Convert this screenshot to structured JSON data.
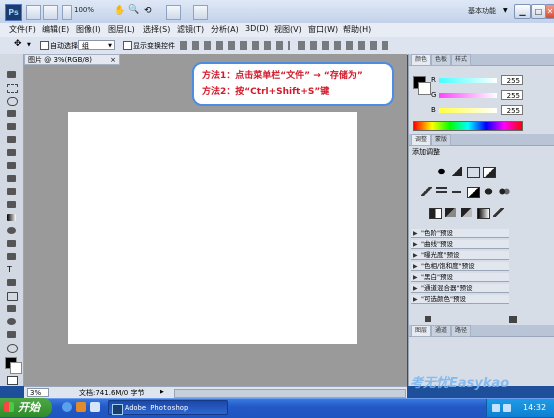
{
  "titlebar": {
    "ps_logo": "Ps",
    "zoom": "100%",
    "workspace": "基本功能",
    "min": "▁",
    "max": "□",
    "close": "✕"
  },
  "menu": [
    "文件(F)",
    "编辑(E)",
    "图像(I)",
    "图层(L)",
    "选择(S)",
    "滤镜(T)",
    "分析(A)",
    "3D(D)",
    "视图(V)",
    "窗口(W)",
    "帮助(H)"
  ],
  "options": {
    "auto_select_label": "自动选择:",
    "auto_select_value": "组",
    "show_transform_label": "显示变换控件"
  },
  "document": {
    "tab_title": "图片 @ 3%(RGB/8)",
    "zoom": "3%",
    "status": "文档:741.6M/0 字节"
  },
  "callout": {
    "line1": "方法1：点击菜单栏“文件” → “存储为”",
    "line2": "方法2：按“Ctrl+Shift+S”键"
  },
  "panels": {
    "color_tab": "颜色",
    "swatches_tab": "色板",
    "styles_tab": "样式",
    "channels": [
      {
        "label": "R",
        "value": "255",
        "color": "#e84a4a"
      },
      {
        "label": "G",
        "value": "255",
        "color": "#4ad24a"
      },
      {
        "label": "B",
        "value": "255",
        "color": "#4a6ae8"
      }
    ],
    "adjust_tab": "调整",
    "mask_tab": "蒙版",
    "adjust_title": "添加调整",
    "presets": [
      "\"色阶\"预设",
      "\"曲线\"预设",
      "\"曝光度\"预设",
      "\"色相/饱和度\"预设",
      "\"黑白\"预设",
      "\"通道混合器\"预设",
      "\"可选颜色\"预设"
    ],
    "layers_tab": "图层",
    "channels_tab": "通道",
    "paths_tab": "路径"
  },
  "taskbar": {
    "start": "开始",
    "app": "Adobe Photoshop",
    "time": "14:32"
  },
  "watermark": "考无忧Easykao"
}
